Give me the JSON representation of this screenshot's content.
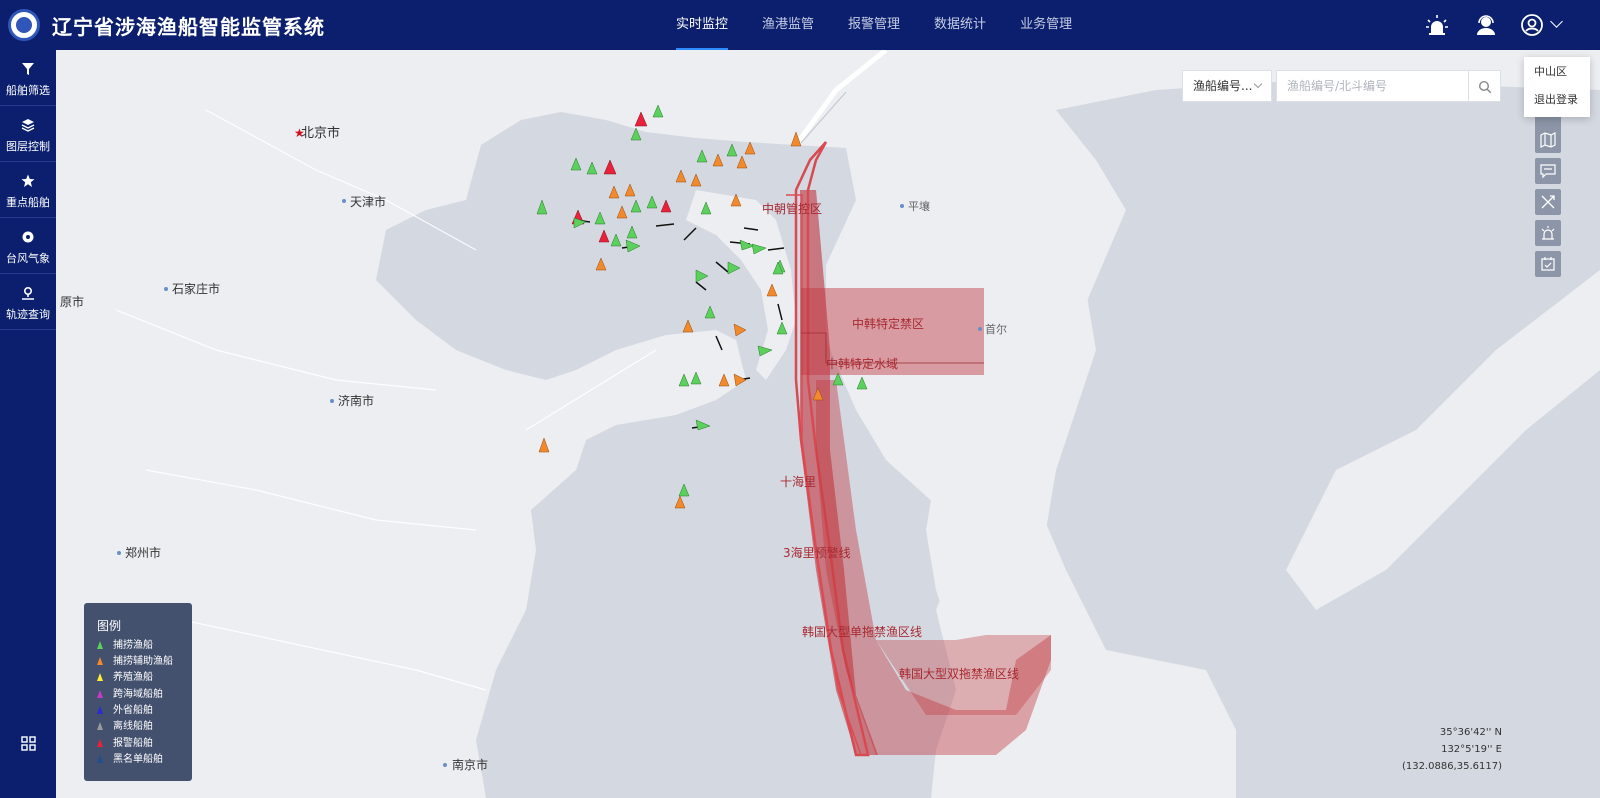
{
  "app": {
    "title": "辽宁省涉海渔船智能监管系统"
  },
  "nav": {
    "items": [
      "实时监控",
      "渔港监管",
      "报警管理",
      "数据统计",
      "业务管理"
    ],
    "active": 0
  },
  "sidebar": {
    "items": [
      {
        "label": "船舶筛选",
        "icon": "filter-icon"
      },
      {
        "label": "图层控制",
        "icon": "layers-icon"
      },
      {
        "label": "重点船舶",
        "icon": "star-icon"
      },
      {
        "label": "台风气象",
        "icon": "typhoon-icon"
      },
      {
        "label": "轨迹查询",
        "icon": "track-pin-icon"
      }
    ]
  },
  "search": {
    "type_selected": "渔船编号...",
    "placeholder": "渔船编号/北斗编号"
  },
  "user_menu": {
    "items": [
      "中山区",
      "退出登录"
    ]
  },
  "map": {
    "cities": [
      "北京市",
      "天津市",
      "石家庄市",
      "原市",
      "济南市",
      "郑州市",
      "南京市",
      "平壤",
      "首尔"
    ],
    "zones": [
      "中朝管控区",
      "中韩特定禁区",
      "中韩特定水域",
      "十海里",
      "3海里预警线",
      "韩国大型单拖禁渔区线",
      "韩国大型双拖禁渔区线"
    ]
  },
  "legend": {
    "title": "图例",
    "items": [
      {
        "label": "捕捞渔船",
        "color": "#5cd05c"
      },
      {
        "label": "捕捞辅助渔船",
        "color": "#f08a2c"
      },
      {
        "label": "养殖渔船",
        "color": "#ffee33"
      },
      {
        "label": "跨海域船舶",
        "color": "#c13cc3"
      },
      {
        "label": "外省船舶",
        "color": "#2b2bd1"
      },
      {
        "label": "离线船舶",
        "color": "#9a9a9a"
      },
      {
        "label": "报警船舶",
        "color": "#e8223a"
      },
      {
        "label": "黑名单船舶",
        "color": "#1f4f8f"
      }
    ]
  },
  "coordinates": {
    "lat": "35°36'42'' N",
    "lon": "132°5'19'' E",
    "decimal": "(132.0886,35.6117)"
  },
  "colors": {
    "header": "#0b1f6e",
    "zone": "#c0363d",
    "sea": "#d4d8e0",
    "land": "#eceef2"
  }
}
